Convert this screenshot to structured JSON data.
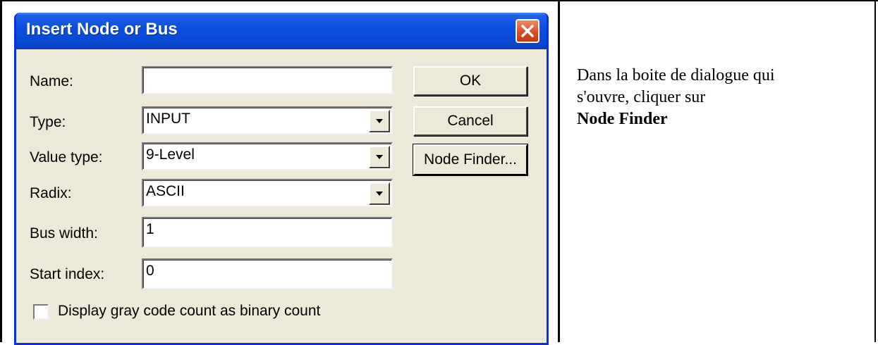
{
  "dialog": {
    "title": "Insert Node or Bus",
    "fields": {
      "name_label": "Name:",
      "name_value": "",
      "type_label": "Type:",
      "type_value": "INPUT",
      "value_type_label": "Value type:",
      "value_type_value": "9-Level",
      "radix_label": "Radix:",
      "radix_value": "ASCII",
      "bus_width_label": "Bus width:",
      "bus_width_value": "1",
      "start_index_label": "Start index:",
      "start_index_value": "0"
    },
    "buttons": {
      "ok": "OK",
      "cancel": "Cancel",
      "node_finder": "Node Finder..."
    },
    "checkbox_label": "Display gray code count as binary count",
    "checkbox_checked": false
  },
  "instructions": {
    "line1": "Dans la boite de dialogue qui",
    "line2": "s'ouvre, cliquer sur",
    "line3": "Node Finder"
  },
  "colors": {
    "titlebar": "#0a4fe0",
    "dialog_bg": "#ece9d8",
    "close_button": "#d84a22"
  }
}
